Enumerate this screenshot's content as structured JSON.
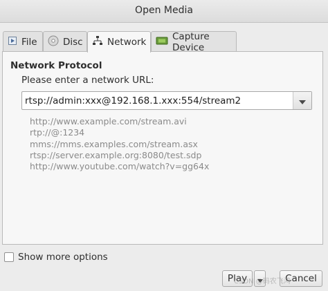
{
  "window": {
    "title": "Open Media"
  },
  "tabs": [
    {
      "label": "File",
      "icon": "file-icon"
    },
    {
      "label": "Disc",
      "icon": "disc-icon"
    },
    {
      "label": "Network",
      "icon": "network-icon",
      "active": true
    },
    {
      "label": "Capture Device",
      "icon": "capture-device-icon"
    }
  ],
  "network": {
    "group_title": "Network Protocol",
    "prompt": "Please enter a network URL:",
    "url_value": "rtsp://admin:xxx@192.168.1.xxx:554/stream2",
    "examples": [
      "http://www.example.com/stream.avi",
      "rtp://@:1234",
      "mms://mms.examples.com/stream.asx",
      "rtsp://server.example.org:8080/test.sdp",
      "http://www.youtube.com/watch?v=gg64x"
    ]
  },
  "footer": {
    "show_more_label": "Show more options",
    "play_label": "Play",
    "cancel_label": "Cancel"
  },
  "watermark": {
    "text": "CSDN @码农飞鸿"
  }
}
